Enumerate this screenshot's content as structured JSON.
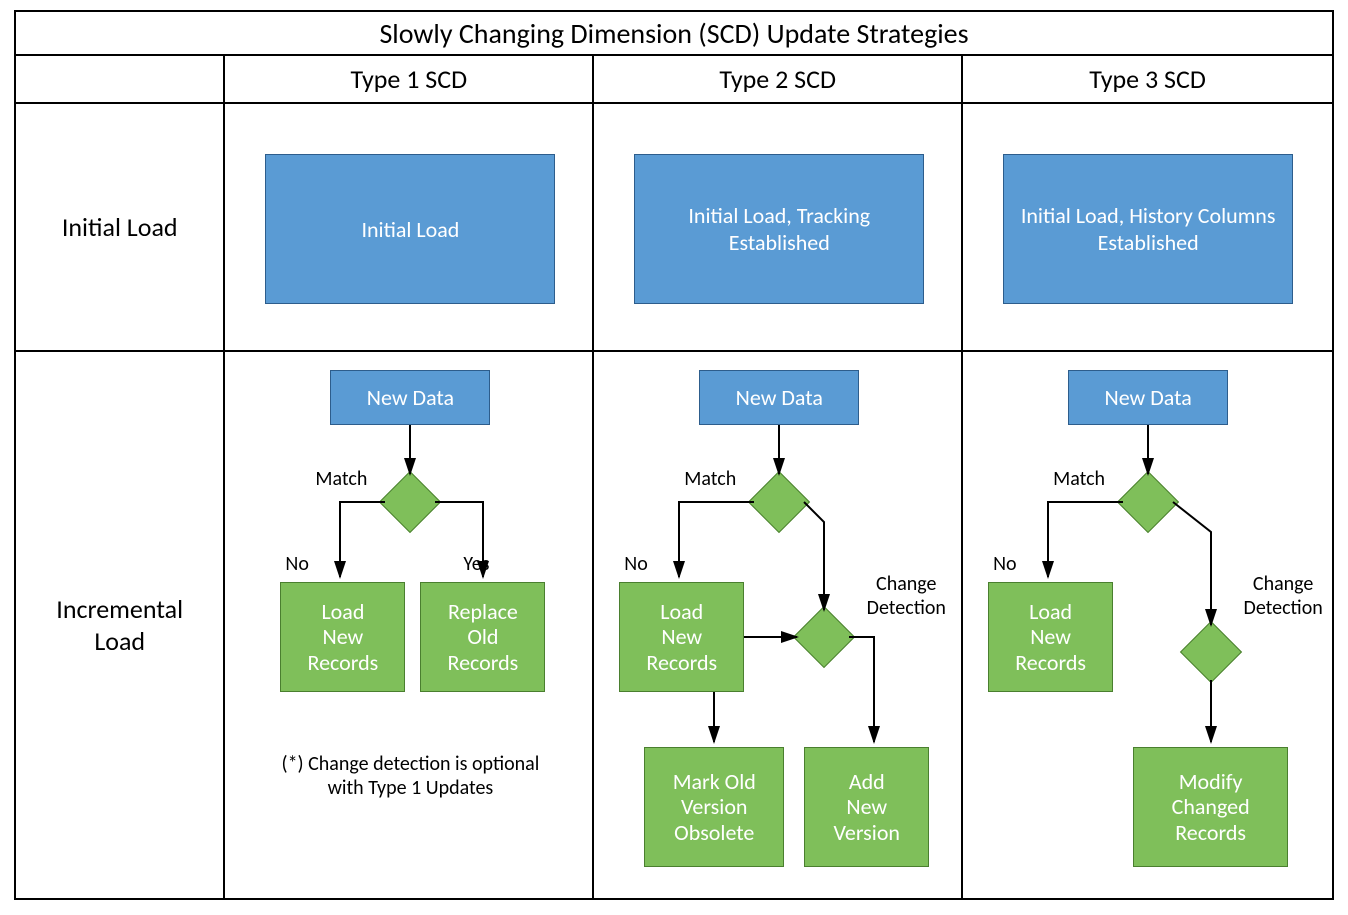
{
  "title": "Slowly Changing Dimension (SCD) Update Strategies",
  "columns": [
    "Type 1 SCD",
    "Type 2 SCD",
    "Type 3 SCD"
  ],
  "rows": {
    "initial": "Initial Load",
    "incremental": "Incremental Load"
  },
  "initial_boxes": {
    "type1": "Initial Load",
    "type2": "Initial Load, Tracking Established",
    "type3": "Initial Load, History Columns Established"
  },
  "new_data": "New Data",
  "labels": {
    "match": "Match",
    "no": "No",
    "yes": "Yes",
    "change_detection": "Change Detection"
  },
  "boxes": {
    "load_new_records": "Load\nNew\nRecords",
    "replace_old_records": "Replace\nOld\nRecords",
    "mark_old_obsolete": "Mark Old\nVersion\nObsolete",
    "add_new_version": "Add\nNew\nVersion",
    "modify_changed_records": "Modify\nChanged\nRecords"
  },
  "footnote": "(*) Change detection is optional with Type 1 Updates"
}
